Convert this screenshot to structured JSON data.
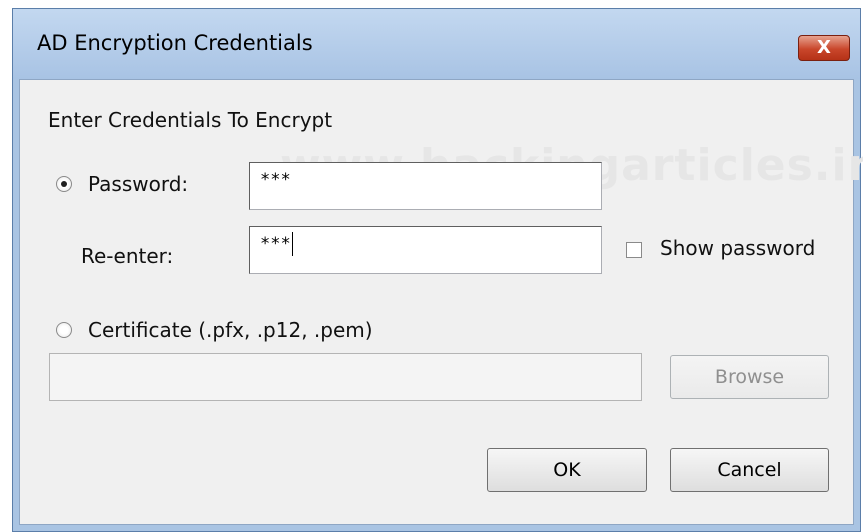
{
  "dialog": {
    "title": "AD Encryption Credentials",
    "close_label": "X"
  },
  "watermark": "www.hackingarticles.in",
  "form": {
    "heading": "Enter Credentials To Encrypt",
    "password_option": {
      "label": "Password:",
      "selected": true
    },
    "password_value": "***",
    "reenter_label": "Re-enter:",
    "reenter_value": "***",
    "show_password_label": "Show password",
    "show_password_checked": false,
    "certificate_option": {
      "label": "Certificate (.pfx, .p12, .pem)",
      "selected": false
    },
    "certificate_path": "",
    "browse_label": "Browse"
  },
  "buttons": {
    "ok_label": "OK",
    "cancel_label": "Cancel"
  }
}
